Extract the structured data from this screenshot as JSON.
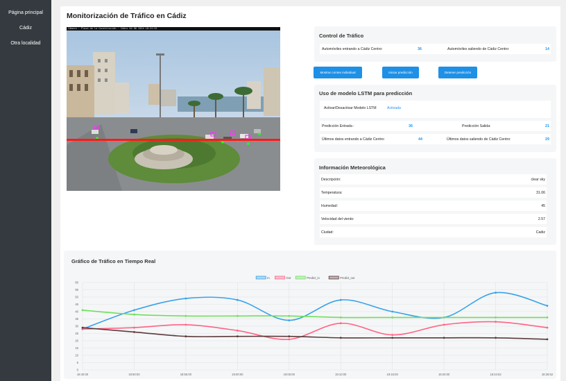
{
  "sidebar": {
    "items": [
      {
        "label": "Página principal"
      },
      {
        "label": "Cádiz"
      },
      {
        "label": "Otra localidad"
      }
    ]
  },
  "page": {
    "title": "Monitorización de Tráfico en Cádiz"
  },
  "camera": {
    "osd_text": "Cámara · Plaza de la Constitución · Cádiz 04 06 2024 18:24:52"
  },
  "traffic_control": {
    "title": "Control de Tráfico",
    "entering_label": "Automóviles entrando a Cádiz Centro:",
    "entering_value": "36",
    "leaving_label": "Automóviles saliendo de Cádiz Centro:",
    "leaving_value": "14"
  },
  "buttons": {
    "show_individual": "Mostrar conteo individual",
    "start_prediction": "Iniciar predicción",
    "stop_prediction": "Detener predicción"
  },
  "lstm": {
    "title": "Uso de modelo LSTM para predicción",
    "toggle_label": "Activar/Desactivar Modelo LSTM",
    "toggle_state": "Activada",
    "pred_in_label": "Predicción Entrada :",
    "pred_in_value": "36",
    "pred_out_label": "Predicción Salida:",
    "pred_out_value": "21",
    "last_in_label": "Últimos datos entrando a Cádiz Centro:",
    "last_in_value": "44",
    "last_out_label": "Últimos datos saliendo de Cádiz Centro:",
    "last_out_value": "29"
  },
  "weather": {
    "title": "Información Meteorológica",
    "rows": [
      {
        "label": "Descripción:",
        "value": "clear sky"
      },
      {
        "label": "Temperatura:",
        "value": "31.06"
      },
      {
        "label": "Humedad:",
        "value": "45"
      },
      {
        "label": "Velocidad del viento:",
        "value": "2.57"
      },
      {
        "label": "Ciudad:",
        "value": "Cadiz"
      }
    ]
  },
  "chart_title": "Gráfico de Tráfico en Tiempo Real",
  "chart_data": {
    "type": "line",
    "x": [
      "18:40:00",
      "18:50:00",
      "18:55:00",
      "19:00:00",
      "19:05:00",
      "19:10:00",
      "19:15:00",
      "19:20:00",
      "18:24:52",
      "18:28:52"
    ],
    "ylim": [
      0,
      60
    ],
    "yticks": [
      0,
      5,
      10,
      15,
      20,
      25,
      30,
      35,
      40,
      45,
      50,
      55,
      60
    ],
    "grid": true,
    "legend": "top-center",
    "series": [
      {
        "name": "In",
        "color": "#36a2eb",
        "values": [
          28,
          41,
          49,
          48,
          34,
          48,
          40,
          36,
          53,
          44
        ]
      },
      {
        "name": "Out",
        "color": "#ff6384",
        "values": [
          28,
          29,
          31,
          27,
          21,
          32,
          24,
          31,
          33,
          29
        ]
      },
      {
        "name": "Predict_in",
        "color": "#6ee05a",
        "values": [
          41,
          38,
          37,
          37,
          37,
          36,
          36,
          36,
          36,
          36
        ]
      },
      {
        "name": "Predict_out",
        "color": "#5a3a3a",
        "values": [
          29,
          26,
          23,
          23,
          23,
          22,
          22,
          22,
          22,
          21
        ]
      }
    ]
  }
}
